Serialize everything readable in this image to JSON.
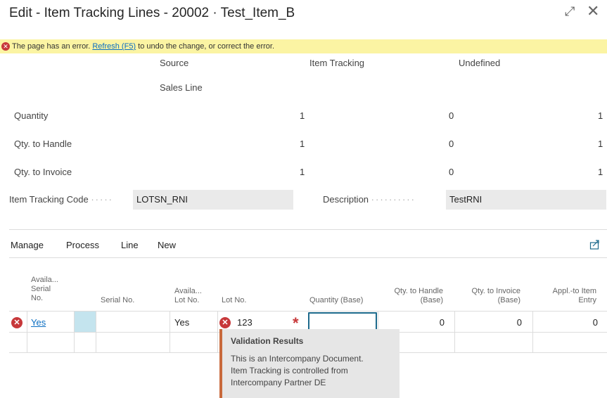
{
  "window": {
    "title": "Edit - Item Tracking Lines - 20002 · Test_Item_B"
  },
  "error_bar": {
    "prefix": "The page has an error. ",
    "link": "Refresh (F5)",
    "suffix": " to undo the change, or correct the error."
  },
  "summary": {
    "headers": {
      "source": "Source",
      "item_tracking": "Item Tracking",
      "undefined": "Undefined"
    },
    "source_sub": "Sales Line",
    "rows": [
      {
        "label": "Quantity",
        "source": "1",
        "item_tracking": "0",
        "undefined": "1"
      },
      {
        "label": "Qty. to Handle",
        "source": "1",
        "item_tracking": "0",
        "undefined": "1"
      },
      {
        "label": "Qty. to Invoice",
        "source": "1",
        "item_tracking": "0",
        "undefined": "1"
      }
    ]
  },
  "fields": {
    "item_tracking_code_label": "Item Tracking Code",
    "item_tracking_code_value": "LOTSN_RNI",
    "description_label": "Description",
    "description_value": "TestRNI"
  },
  "menu": [
    "Manage",
    "Process",
    "Line",
    "New"
  ],
  "columns": {
    "avail_serial": [
      "Availa...",
      "Serial",
      "No."
    ],
    "serial_no": "Serial No.",
    "avail_lot": [
      "Availa...",
      "Lot No."
    ],
    "lot_no": "Lot No.",
    "quantity_base": "Quantity (Base)",
    "qty_handle": [
      "Qty. to Handle",
      "(Base)"
    ],
    "qty_invoice": [
      "Qty. to Invoice",
      "(Base)"
    ],
    "appl_to_item": [
      "Appl.-to Item",
      "Entry"
    ]
  },
  "row": {
    "avail_serial": "Yes",
    "avail_lot": "Yes",
    "lot_no": "123",
    "qty_handle": "0",
    "qty_invoice": "0",
    "appl_to_item": "0"
  },
  "popup": {
    "title": "Validation Results",
    "lines": [
      "This is an Intercompany Document.",
      "Item Tracking is controlled from",
      "Intercompany Partner DE"
    ]
  },
  "colors": {
    "error": "#c7383a",
    "warning_bar": "#fbf4a3",
    "link": "#0b6ec2",
    "accent": "#1d6a8c",
    "popup_border": "#c8693b"
  }
}
